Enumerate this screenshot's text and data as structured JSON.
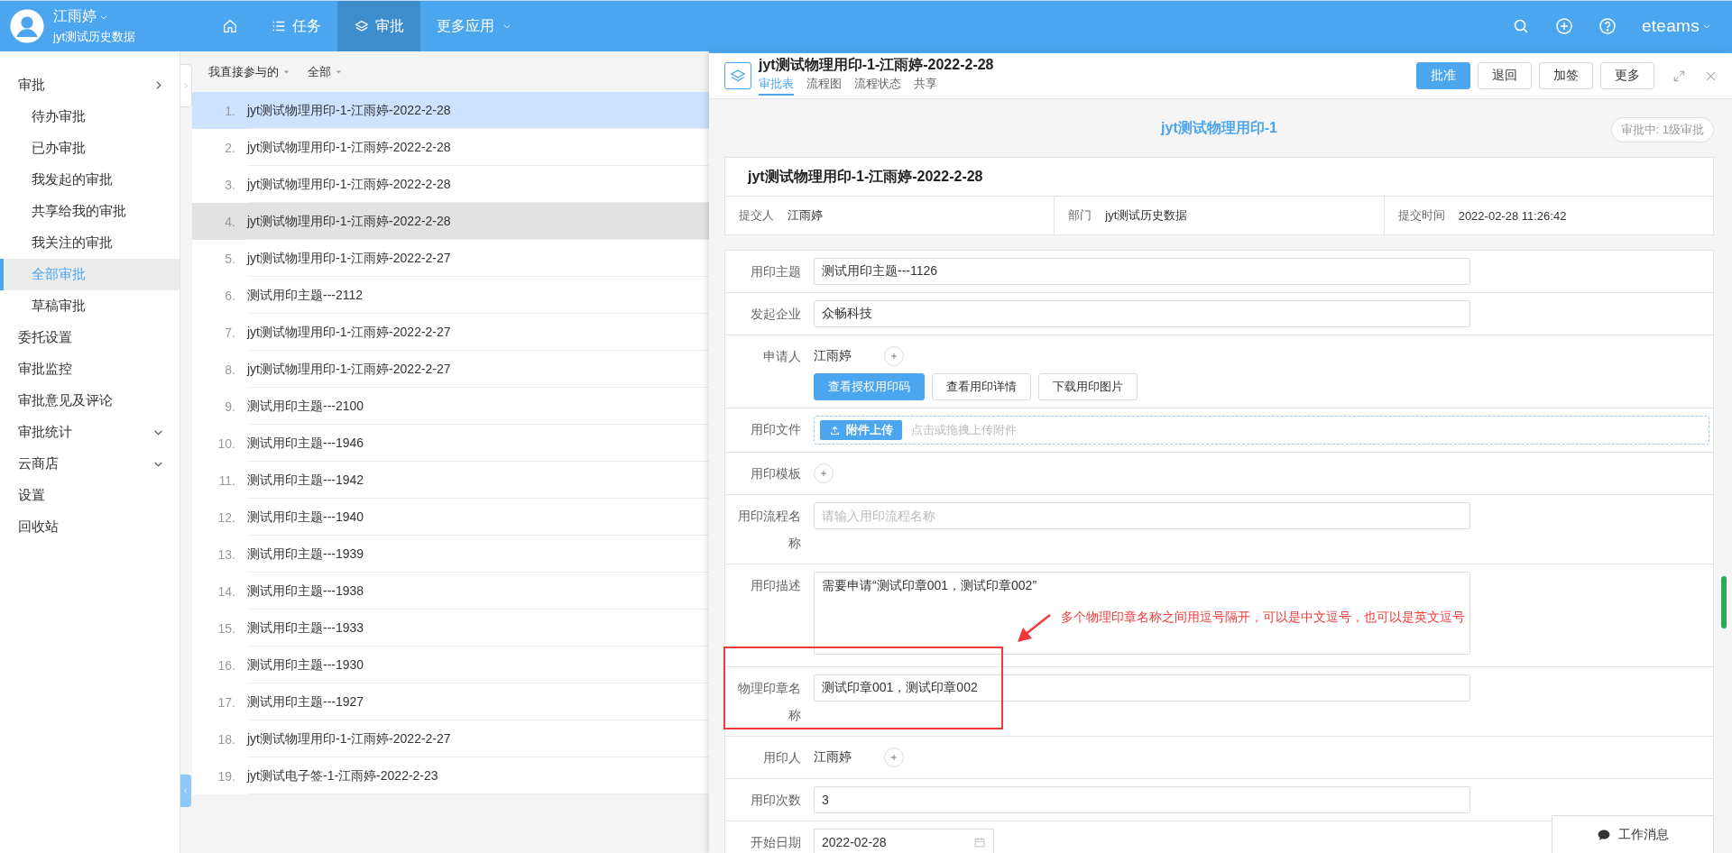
{
  "topbar": {
    "user_name": "江雨婷",
    "user_org": "jyt测试历史数据",
    "nav": [
      {
        "kind": "home",
        "selected": false
      },
      {
        "kind": "list",
        "label": "任务",
        "selected": false
      },
      {
        "kind": "layers",
        "label": "审批",
        "selected": true
      },
      {
        "kind": "more",
        "label": "更多应用",
        "selected": false
      }
    ],
    "brand": "eteams"
  },
  "sidebar": {
    "items": [
      {
        "label": "审批",
        "expanded": true,
        "selected": false,
        "children": [
          {
            "label": "待办审批",
            "selected": false
          },
          {
            "label": "已办审批",
            "selected": false
          },
          {
            "label": "我发起的审批",
            "selected": false
          },
          {
            "label": "共享给我的审批",
            "selected": false
          },
          {
            "label": "我关注的审批",
            "selected": false
          },
          {
            "label": "全部审批",
            "selected": true
          },
          {
            "label": "草稿审批",
            "selected": false
          }
        ]
      },
      {
        "label": "委托设置",
        "selected": false
      },
      {
        "label": "审批监控",
        "selected": false
      },
      {
        "label": "审批意见及评论",
        "selected": false
      },
      {
        "label": "审批统计",
        "expanded": false,
        "selected": false
      },
      {
        "label": "云商店",
        "expanded": false,
        "selected": false
      },
      {
        "label": "设置",
        "selected": false
      },
      {
        "label": "回收站",
        "selected": false
      }
    ]
  },
  "list": {
    "filters": [
      "我直接参与的",
      "全部"
    ],
    "rows": [
      {
        "number": "1.",
        "title": "jyt测试物理用印-1-江雨婷-2022-2-28",
        "selected": true,
        "hovered": false
      },
      {
        "number": "2.",
        "title": "jyt测试物理用印-1-江雨婷-2022-2-28",
        "selected": false,
        "hovered": false
      },
      {
        "number": "3.",
        "title": "jyt测试物理用印-1-江雨婷-2022-2-28",
        "selected": false,
        "hovered": false
      },
      {
        "number": "4.",
        "title": "jyt测试物理用印-1-江雨婷-2022-2-28",
        "selected": false,
        "hovered": true
      },
      {
        "number": "5.",
        "title": "jyt测试物理用印-1-江雨婷-2022-2-27",
        "selected": false,
        "hovered": false
      },
      {
        "number": "6.",
        "title": "测试用印主题---2112",
        "selected": false,
        "hovered": false
      },
      {
        "number": "7.",
        "title": "jyt测试物理用印-1-江雨婷-2022-2-27",
        "selected": false,
        "hovered": false
      },
      {
        "number": "8.",
        "title": "jyt测试物理用印-1-江雨婷-2022-2-27",
        "selected": false,
        "hovered": false
      },
      {
        "number": "9.",
        "title": "测试用印主题---2100",
        "selected": false,
        "hovered": false
      },
      {
        "number": "10.",
        "title": "测试用印主题---1946",
        "selected": false,
        "hovered": false
      },
      {
        "number": "11.",
        "title": "测试用印主题---1942",
        "selected": false,
        "hovered": false
      },
      {
        "number": "12.",
        "title": "测试用印主题---1940",
        "selected": false,
        "hovered": false
      },
      {
        "number": "13.",
        "title": "测试用印主题---1939",
        "selected": false,
        "hovered": false
      },
      {
        "number": "14.",
        "title": "测试用印主题---1938",
        "selected": false,
        "hovered": false
      },
      {
        "number": "15.",
        "title": "测试用印主题---1933",
        "selected": false,
        "hovered": false
      },
      {
        "number": "16.",
        "title": "测试用印主题---1930",
        "selected": false,
        "hovered": false
      },
      {
        "number": "17.",
        "title": "测试用印主题---1927",
        "selected": false,
        "hovered": false
      },
      {
        "number": "18.",
        "title": "jyt测试物理用印-1-江雨婷-2022-2-27",
        "selected": false,
        "hovered": false
      },
      {
        "number": "19.",
        "title": "jyt测试电子签-1-江雨婷-2022-2-23",
        "selected": false,
        "hovered": false
      }
    ]
  },
  "detail": {
    "title": "jyt测试物理用印-1-江雨婷-2022-2-28",
    "tabs": [
      {
        "label": "审批表",
        "selected": true
      },
      {
        "label": "流程图",
        "selected": false
      },
      {
        "label": "流程状态",
        "selected": false
      },
      {
        "label": "共享",
        "selected": false
      }
    ],
    "buttons": [
      {
        "label": "批准",
        "primary": true
      },
      {
        "label": "退回",
        "primary": false
      },
      {
        "label": "加签",
        "primary": false
      },
      {
        "label": "更多",
        "primary": false
      }
    ],
    "form_title": "jyt测试物理用印-1",
    "status": "审批中: 1级审批",
    "card_title": "jyt测试物理用印-1-江雨婷-2022-2-28",
    "meta": [
      {
        "label": "提交人",
        "value": "江雨婷"
      },
      {
        "label": "部门",
        "value": "jyt测试历史数据"
      },
      {
        "label": "提交时间",
        "value": "2022-02-28 11:26:42"
      }
    ],
    "fields": [
      {
        "kind": "input",
        "label": "用印主题",
        "value": "测试用印主题---1126"
      },
      {
        "kind": "input",
        "label": "发起企业",
        "value": "众畅科技"
      },
      {
        "kind": "person",
        "label": "申请人",
        "value": "江雨婷",
        "buttons": [
          {
            "label": "查看授权用印码",
            "primary": true
          },
          {
            "label": "查看用印详情",
            "primary": false
          },
          {
            "label": "下载用印图片",
            "primary": false
          }
        ]
      },
      {
        "kind": "upload",
        "label": "用印文件",
        "button": "附件上传",
        "hint": "点击或拖拽上传附件"
      },
      {
        "kind": "add",
        "label": "用印模板"
      },
      {
        "kind": "input",
        "label": "用印流程名称",
        "placeholder": "请输入用印流程名称"
      },
      {
        "kind": "textarea",
        "label": "用印描述",
        "value": "需要申请“测试印章001，测试印章002”"
      },
      {
        "kind": "input",
        "label": "物理印章名称",
        "value": "测试印章001，测试印章002",
        "annotation": "多个物理印章名称之间用逗号隔开，可以是中文逗号，也可以是英文逗号"
      },
      {
        "kind": "person",
        "label": "用印人",
        "value": "江雨婷"
      },
      {
        "kind": "input",
        "label": "用印次数",
        "value": "3"
      },
      {
        "kind": "date",
        "label": "开始日期",
        "value": "2022-02-28"
      }
    ]
  },
  "chat_button": "工作消息"
}
